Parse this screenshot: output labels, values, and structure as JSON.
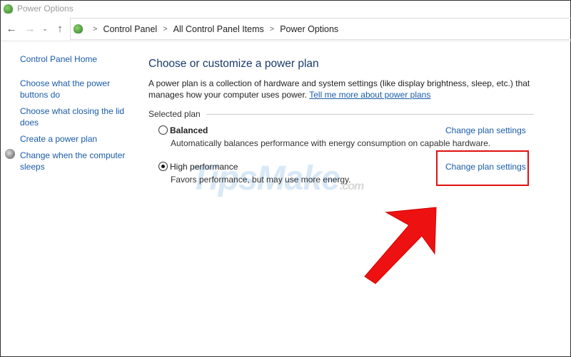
{
  "window": {
    "title": "Power Options"
  },
  "breadcrumb": [
    "Control Panel",
    "All Control Panel Items",
    "Power Options"
  ],
  "sidebar": {
    "items": [
      {
        "label": "Control Panel Home"
      },
      {
        "label": "Choose what the power buttons do"
      },
      {
        "label": "Choose what closing the lid does"
      },
      {
        "label": "Create a power plan"
      },
      {
        "label": "Change when the computer sleeps"
      }
    ]
  },
  "main": {
    "title": "Choose or customize a power plan",
    "description": "A power plan is a collection of hardware and system settings (like display brightness, sleep, etc.) that manages how your computer uses power.",
    "link": "Tell me more about power plans",
    "group": "Selected plan",
    "plans": [
      {
        "name": "Balanced",
        "description": "Automatically balances performance with energy consumption on capable hardware.",
        "action": "Change plan settings",
        "selected": false
      },
      {
        "name": "High performance",
        "description": "Favors performance, but may use more energy.",
        "action": "Change plan settings",
        "selected": true
      }
    ]
  },
  "watermark": "TipsMake.com",
  "colors": {
    "highlight": "#e01010",
    "link": "#1a5ca8"
  }
}
